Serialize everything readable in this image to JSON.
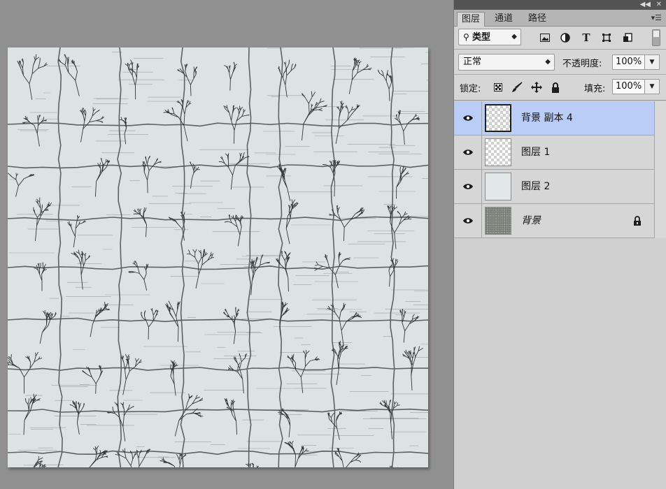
{
  "panel": {
    "tabs": [
      {
        "label": "图层",
        "active": true
      },
      {
        "label": "通道",
        "active": false
      },
      {
        "label": "路径",
        "active": false
      }
    ],
    "filter": {
      "label": "类型",
      "icon": "search-icon"
    },
    "filter_icons": [
      "image-filter-icon",
      "adjustment-filter-icon",
      "type-filter-icon",
      "shape-filter-icon",
      "smart-object-filter-icon"
    ],
    "blend_mode": "正常",
    "opacity_label": "不透明度:",
    "opacity_value": "100%",
    "lock_label": "锁定:",
    "lock_icons": [
      "lock-transparent-icon",
      "lock-paint-icon",
      "lock-position-icon",
      "lock-all-icon"
    ],
    "fill_label": "填充:",
    "fill_value": "100%",
    "layers": [
      {
        "name": "背景 副本 4",
        "visible": true,
        "selected": true,
        "thumb": "transparent"
      },
      {
        "name": "图层 1",
        "visible": true,
        "selected": false,
        "thumb": "transparent"
      },
      {
        "name": "图层 2",
        "visible": true,
        "selected": false,
        "thumb": "light"
      },
      {
        "name": "背景",
        "visible": true,
        "selected": false,
        "thumb": "texture",
        "locked": true,
        "italic": true
      }
    ]
  },
  "colors": {
    "workspace": "#909090",
    "panel": "#d6d6d6",
    "selected_layer": "#b9cdf7",
    "canvas_bg": "#dde3e3",
    "branch_ink": "#2f3a36"
  }
}
